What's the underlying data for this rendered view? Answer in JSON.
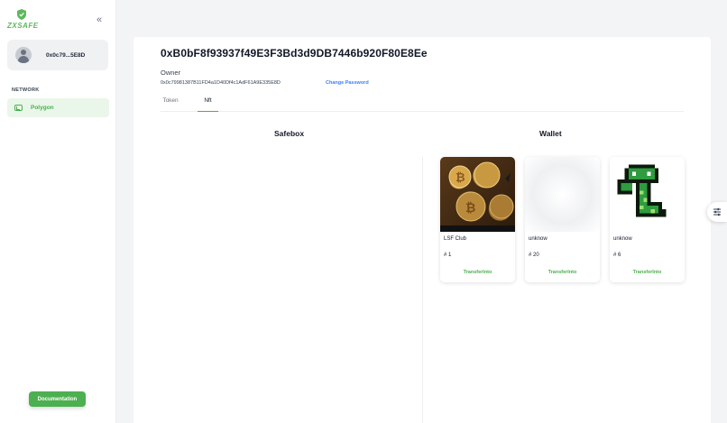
{
  "sidebar": {
    "logo_text": "ZXSAFE",
    "account": {
      "address": "0x0c79...5E8D"
    },
    "network_label": "NETWORK",
    "network": {
      "name": "Polygon"
    },
    "documentation_label": "Documentation"
  },
  "header": {
    "title": "0xB0bF8f93937f49E3F3Bd3d9DB7446b920F80E8Ee",
    "owner_label": "Owner",
    "owner_address": "0x0c79981387B11FD4a1D40Df4c1AdF61A9E335E8D",
    "change_password_label": "Change Password"
  },
  "tabs": [
    {
      "label": "Token",
      "active": false
    },
    {
      "label": "Nft",
      "active": true
    }
  ],
  "safebox": {
    "title": "Safebox"
  },
  "wallet": {
    "title": "Wallet",
    "nfts": [
      {
        "name": "LSF Club",
        "number": "# 1",
        "action": "TransferInto",
        "image": "bitcoin-coins-image"
      },
      {
        "name": "unknow",
        "number": "# 20",
        "action": "TransferInto",
        "image": "blank-placeholder-image"
      },
      {
        "name": "unknow",
        "number": "# 6",
        "action": "TransferInto",
        "image": "pixel-snake-image"
      }
    ]
  },
  "colors": {
    "accent": "#4caf50",
    "link": "#3b82f6",
    "background": "#f3f4f6"
  },
  "icons": {
    "collapse": "chevrons-left-icon",
    "settings": "sliders-icon"
  }
}
